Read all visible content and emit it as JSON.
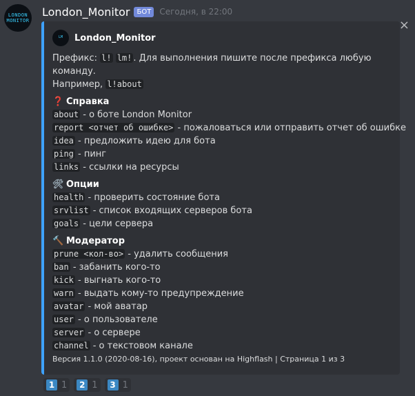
{
  "message": {
    "avatar_text": "LONDON\nMONITOR",
    "username": "London_Monitor",
    "bot_tag": "БОТ",
    "timestamp": "Сегодня, в 22:00"
  },
  "embed": {
    "author_name": "London_Monitor",
    "description": {
      "prefix_label": "Префикс:",
      "prefix1": "l!",
      "prefix2": "lm!",
      "text1": ". Для выполнения пишите после префикса любую команду.",
      "text2": "Например,",
      "example": "l!about"
    },
    "sections": [
      {
        "icon": "question-icon",
        "title": "Справка",
        "commands": [
          {
            "cmd": "about",
            "desc": " - о боте London Monitor"
          },
          {
            "cmd": "report <отчет об ошибке>",
            "desc": " - пожаловаться или отправить отчет об ошибке"
          },
          {
            "cmd": "idea",
            "desc": " - предложить идею для бота"
          },
          {
            "cmd": "ping",
            "desc": " - пинг"
          },
          {
            "cmd": "links",
            "desc": " - ссылки на ресурсы"
          }
        ]
      },
      {
        "icon": "tools-icon",
        "title": "Опции",
        "commands": [
          {
            "cmd": "health",
            "desc": " - проверить состояние бота"
          },
          {
            "cmd": "srvlist",
            "desc": " - список входящих серверов бота"
          },
          {
            "cmd": "goals",
            "desc": " - цели сервера"
          }
        ]
      },
      {
        "icon": "hammer-icon",
        "title": "Модератор",
        "commands": [
          {
            "cmd": "prune <кол-во>",
            "desc": " - удалить сообщения"
          },
          {
            "cmd": "ban",
            "desc": " - забанить кого-то"
          },
          {
            "cmd": "kick",
            "desc": " - выгнать кого-то"
          },
          {
            "cmd": "warn",
            "desc": " - выдать кому-то предупреждение"
          },
          {
            "cmd": "avatar",
            "desc": " - мой аватар"
          },
          {
            "cmd": "user",
            "desc": " - о пользователе"
          },
          {
            "cmd": "server",
            "desc": " - о сервере"
          },
          {
            "cmd": "channel",
            "desc": " - о текстовом канале"
          }
        ]
      }
    ],
    "footer": "Версия 1.1.0 (2020-08-16), проект основан на Highflash | Страница 1 из 3",
    "accent_color": "#3ea2ff"
  },
  "reactions": [
    {
      "emoji": "1",
      "count": "1"
    },
    {
      "emoji": "2",
      "count": "1"
    },
    {
      "emoji": "3",
      "count": "1"
    }
  ],
  "close_icon": "×"
}
